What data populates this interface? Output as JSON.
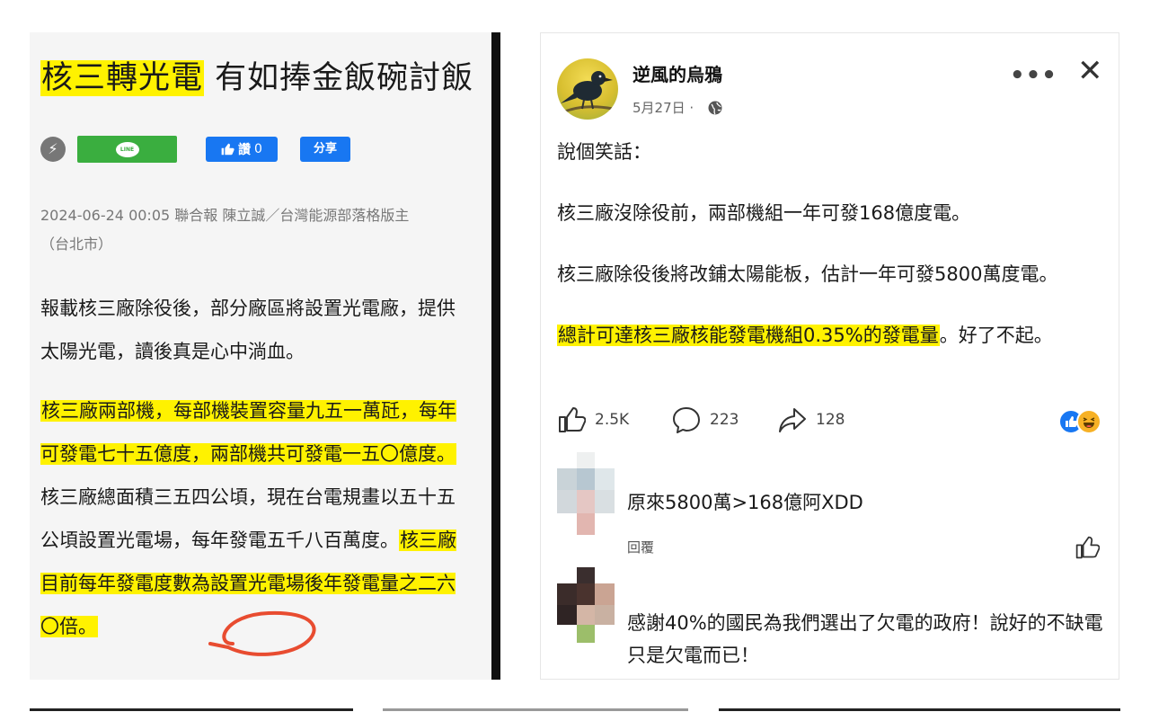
{
  "article": {
    "headline_highlight": "核三轉光電",
    "headline_rest": " 有如捧金飯碗討飯",
    "line_label": "LINE",
    "fb_like_label": "讚",
    "fb_like_count": "0",
    "fb_share_label": "分享",
    "meta_line1": "2024-06-24 00:05  聯合報 陳立誠／台灣能源部落格版主",
    "meta_line2": "（台北市）",
    "para1": "報載核三廠除役後，部分廠區將設置光電廠，提供太陽光電，讀後真是心中淌血。",
    "para2_hl1": "核三廠兩部機，每部機裝置容量九五一萬瓩，每年可發電七十五億度，兩部機共可發電一五〇億度。",
    "para2_mid": "核三廠總面積三五四公頃，現在台電規畫以五十五公頃設置光電場，每年發電五千八百萬度。",
    "para2_hl2": "核三廠目前每年發電度數為設置光電場後年發電量之二六〇倍。"
  },
  "post": {
    "author": "逆風的烏鴉",
    "date": "5月27日 ·",
    "more_label": "•••",
    "close_label": "✕",
    "p1": "說個笑話：",
    "p2": "核三廠沒除役前，兩部機組一年可發168億度電。",
    "p3": "核三廠除役後將改鋪太陽能板，估計一年可發5800萬度電。",
    "p4_hl": "總計可達核三廠核能發電機組0.35%的發電量",
    "p4_rest": "。好了不起。",
    "likes": "2.5K",
    "comments": "223",
    "shares": "128"
  },
  "comments": [
    {
      "text": "原來5800萬>168億阿XDD",
      "reply_label": "回覆"
    },
    {
      "text": "感謝40%的國民為我們選出了欠電的政府！說好的不缺電只是欠電而已！"
    }
  ],
  "colors": {
    "highlight": "#fff200",
    "fb_blue": "#1877f2",
    "line_green": "#3aae3f",
    "annotation_red": "#e84c30"
  },
  "icons": [
    "bolt-icon",
    "line-icon",
    "thumbs-up-icon",
    "globe-icon",
    "more-icon",
    "close-icon",
    "comment-icon",
    "share-arrow-icon",
    "like-reaction-icon",
    "haha-reaction-icon"
  ]
}
